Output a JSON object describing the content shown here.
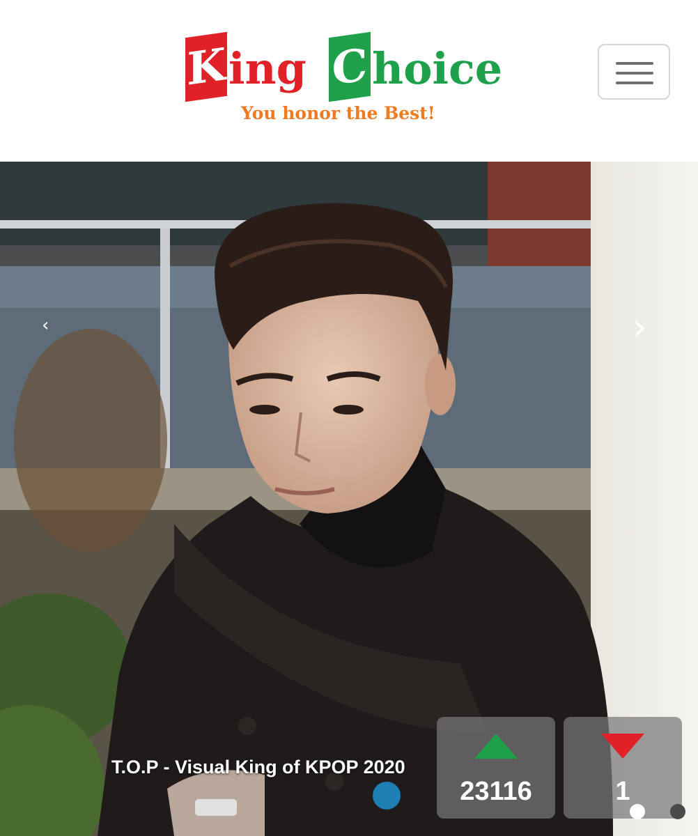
{
  "header": {
    "logo": {
      "king_initial": "K",
      "king_rest": "ing",
      "choice_initial": "C",
      "choice_rest": "hoice",
      "tagline": "You honor the Best!"
    },
    "menu_icon": "hamburger-menu-icon"
  },
  "slider": {
    "prev_glyph": "‹",
    "next_glyph": "›",
    "caption": "T.O.P - Visual King of KPOP 2020",
    "upvote": {
      "icon": "triangle-up-icon",
      "color": "#1fa04a",
      "count": "23116"
    },
    "downvote": {
      "icon": "triangle-down-icon",
      "color": "#e02228",
      "count": "1"
    },
    "active_slide": 1,
    "total_slides": 2
  },
  "colors": {
    "brand_red": "#e02228",
    "brand_green": "#1fa04a",
    "tagline_orange": "#f07a22"
  }
}
